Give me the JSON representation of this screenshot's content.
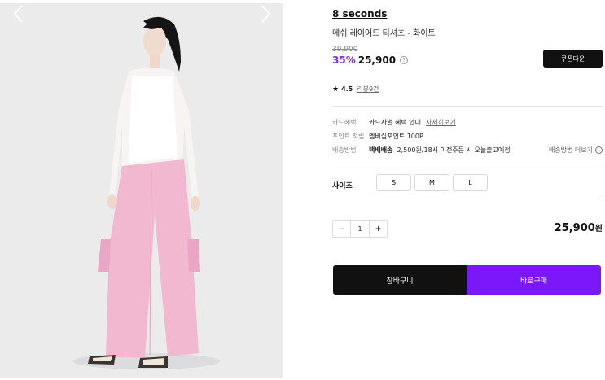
{
  "product": {
    "brand": "8 seconds",
    "name": "메쉬 레이어드 티셔츠 - 화이트",
    "original_price": "39,900",
    "discount": "35%",
    "sale_price": "25,900",
    "help_icon": "?",
    "coupon_label": "쿠폰다운"
  },
  "rating": {
    "star": "★",
    "score": "4.5",
    "review_link": "리뷰9건"
  },
  "details": {
    "card_label": "카드혜택",
    "card_value": "카드사별 혜택 안내",
    "card_link": "자세히보기",
    "point_label": "포인트 적립",
    "point_value": "멤버십포인트 100P",
    "ship_label": "배송방법",
    "ship_method": "택배배송",
    "ship_info": "2,500원/18시 이전주문 시 오늘출고예정",
    "ship_more": "배송방법 더보기",
    "ship_more_icon": "⌄"
  },
  "size": {
    "label": "사이즈",
    "options": [
      "S",
      "M",
      "L"
    ]
  },
  "quantity": {
    "minus": "−",
    "value": "1",
    "plus": "+"
  },
  "total": {
    "amount": "25,900",
    "unit": "원"
  },
  "actions": {
    "cart_label": "장바구니",
    "buy_label": "바로구매"
  },
  "gallery": {
    "prev_icon": "chevron-left-icon",
    "next_icon": "chevron-right-icon"
  },
  "colors": {
    "accent": "#7b17fb",
    "discount": "#7b2ff0",
    "dark": "#111111"
  }
}
